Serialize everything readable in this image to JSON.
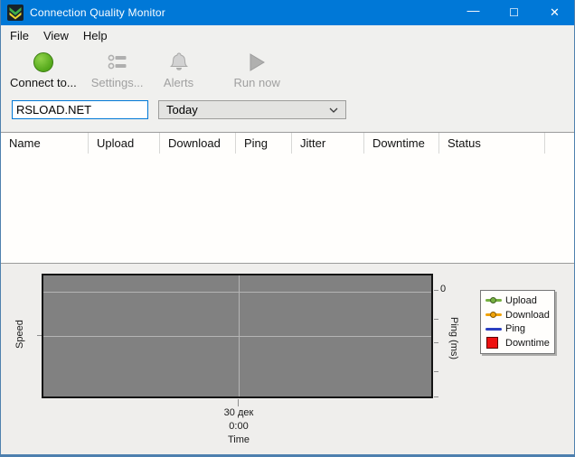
{
  "window": {
    "title": "Connection Quality Monitor"
  },
  "titlebar": {
    "minimize_glyph": "—",
    "maximize_glyph": "☐",
    "close_glyph": "✕"
  },
  "colors": {
    "titlebar": "#0078d7",
    "accent": "#0078d7",
    "panel": "#f0f0ee",
    "plot_background": "#818181"
  },
  "menubar": {
    "items": [
      "File",
      "View",
      "Help"
    ]
  },
  "toolbar": {
    "buttons": [
      {
        "label": "Connect to...",
        "icon": "connect-icon",
        "enabled": true
      },
      {
        "label": "Settings...",
        "icon": "settings-icon",
        "enabled": false
      },
      {
        "label": "Alerts",
        "icon": "bell-icon",
        "enabled": false
      },
      {
        "label": "Run now",
        "icon": "play-icon",
        "enabled": false
      }
    ]
  },
  "controls": {
    "server_input": {
      "value": "RSLOAD.NET"
    },
    "period_dropdown": {
      "selected": "Today"
    }
  },
  "table": {
    "columns": [
      "Name",
      "Upload",
      "Download",
      "Ping",
      "Jitter",
      "Downtime",
      "Status"
    ],
    "rows": []
  },
  "chart_data": {
    "type": "line",
    "title": "",
    "xlabel": "Time",
    "ylabel_left": "Speed",
    "ylabel_right": "Ping (ms)",
    "x_tick_labels": [
      "30 дек",
      "0:00"
    ],
    "right_axis_tick_labels": [
      "0"
    ],
    "grid": true,
    "legend_position": "right",
    "series": [
      {
        "name": "Upload",
        "color": "#76b041",
        "marker": "line-dot",
        "values": []
      },
      {
        "name": "Download",
        "color": "#f0a30a",
        "marker": "line-dot",
        "values": []
      },
      {
        "name": "Ping",
        "color": "#2b3fc0",
        "marker": "line",
        "values": []
      },
      {
        "name": "Downtime",
        "color": "#ee1010",
        "marker": "square",
        "values": []
      }
    ]
  }
}
